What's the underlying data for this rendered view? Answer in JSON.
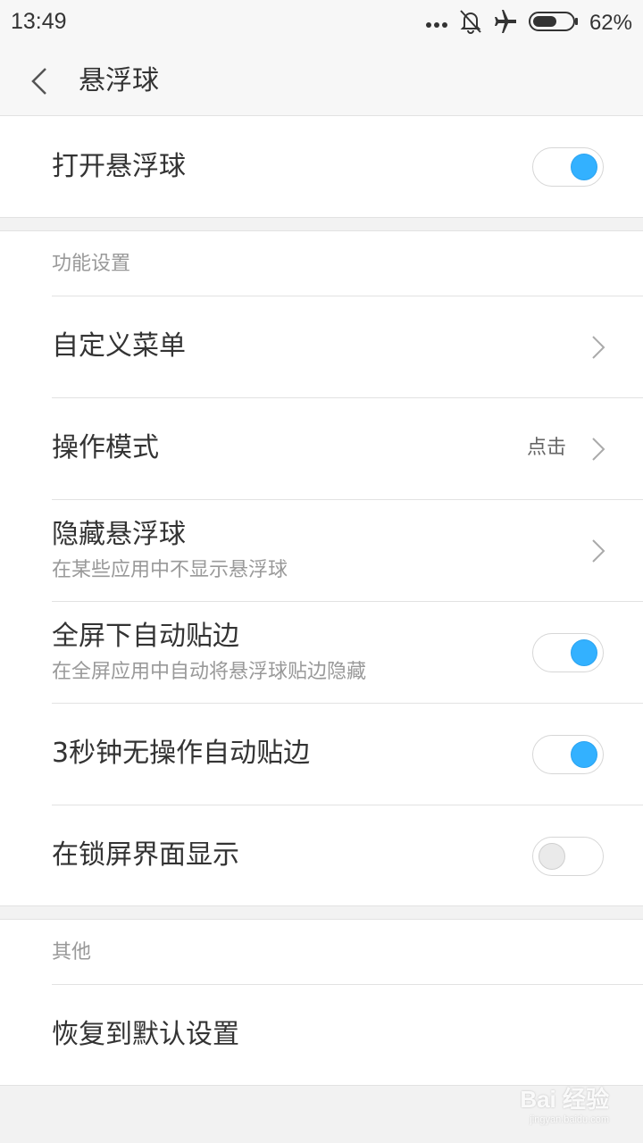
{
  "status": {
    "time": "13:49",
    "battery_percent": "62%",
    "battery_level": 0.62,
    "icons": [
      "more-dots-icon",
      "bell-off-icon",
      "airplane-icon",
      "battery-icon"
    ]
  },
  "header": {
    "title": "悬浮球",
    "back_icon": "chevron-left-icon"
  },
  "colors": {
    "accent": "#33b1ff",
    "background": "#f2f2f2",
    "card": "#ffffff",
    "primary_text": "#333333",
    "secondary_text": "#999999"
  },
  "main_toggle": {
    "label": "打开悬浮球",
    "on": true
  },
  "function_settings": {
    "header": "功能设置",
    "items": [
      {
        "label": "自定义菜单",
        "type": "link"
      },
      {
        "label": "操作模式",
        "value": "点击",
        "type": "link"
      },
      {
        "label": "隐藏悬浮球",
        "subtitle": "在某些应用中不显示悬浮球",
        "type": "link"
      },
      {
        "label": "全屏下自动贴边",
        "subtitle": "在全屏应用中自动将悬浮球贴边隐藏",
        "type": "toggle",
        "on": true
      },
      {
        "label": "3秒钟无操作自动贴边",
        "type": "toggle",
        "on": true
      },
      {
        "label": "在锁屏界面显示",
        "type": "toggle",
        "on": false
      }
    ]
  },
  "other": {
    "header": "其他",
    "items": [
      {
        "label": "恢复到默认设置",
        "type": "action"
      }
    ]
  },
  "watermark": {
    "brand": "Bai 经验",
    "url": "jingyan.baidu.com"
  }
}
